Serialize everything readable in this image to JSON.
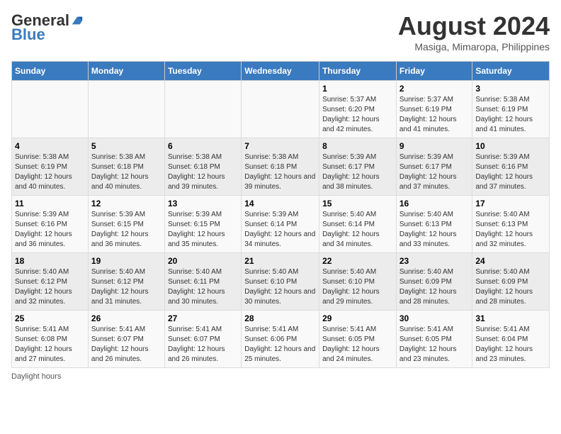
{
  "header": {
    "logo_general": "General",
    "logo_blue": "Blue",
    "month_year": "August 2024",
    "location": "Masiga, Mimaropa, Philippines"
  },
  "days_of_week": [
    "Sunday",
    "Monday",
    "Tuesday",
    "Wednesday",
    "Thursday",
    "Friday",
    "Saturday"
  ],
  "weeks": [
    [
      {
        "day": "",
        "sunrise": "",
        "sunset": "",
        "daylight": ""
      },
      {
        "day": "",
        "sunrise": "",
        "sunset": "",
        "daylight": ""
      },
      {
        "day": "",
        "sunrise": "",
        "sunset": "",
        "daylight": ""
      },
      {
        "day": "",
        "sunrise": "",
        "sunset": "",
        "daylight": ""
      },
      {
        "day": "1",
        "sunrise": "Sunrise: 5:37 AM",
        "sunset": "Sunset: 6:20 PM",
        "daylight": "Daylight: 12 hours and 42 minutes."
      },
      {
        "day": "2",
        "sunrise": "Sunrise: 5:37 AM",
        "sunset": "Sunset: 6:19 PM",
        "daylight": "Daylight: 12 hours and 41 minutes."
      },
      {
        "day": "3",
        "sunrise": "Sunrise: 5:38 AM",
        "sunset": "Sunset: 6:19 PM",
        "daylight": "Daylight: 12 hours and 41 minutes."
      }
    ],
    [
      {
        "day": "4",
        "sunrise": "Sunrise: 5:38 AM",
        "sunset": "Sunset: 6:19 PM",
        "daylight": "Daylight: 12 hours and 40 minutes."
      },
      {
        "day": "5",
        "sunrise": "Sunrise: 5:38 AM",
        "sunset": "Sunset: 6:18 PM",
        "daylight": "Daylight: 12 hours and 40 minutes."
      },
      {
        "day": "6",
        "sunrise": "Sunrise: 5:38 AM",
        "sunset": "Sunset: 6:18 PM",
        "daylight": "Daylight: 12 hours and 39 minutes."
      },
      {
        "day": "7",
        "sunrise": "Sunrise: 5:38 AM",
        "sunset": "Sunset: 6:18 PM",
        "daylight": "Daylight: 12 hours and 39 minutes."
      },
      {
        "day": "8",
        "sunrise": "Sunrise: 5:39 AM",
        "sunset": "Sunset: 6:17 PM",
        "daylight": "Daylight: 12 hours and 38 minutes."
      },
      {
        "day": "9",
        "sunrise": "Sunrise: 5:39 AM",
        "sunset": "Sunset: 6:17 PM",
        "daylight": "Daylight: 12 hours and 37 minutes."
      },
      {
        "day": "10",
        "sunrise": "Sunrise: 5:39 AM",
        "sunset": "Sunset: 6:16 PM",
        "daylight": "Daylight: 12 hours and 37 minutes."
      }
    ],
    [
      {
        "day": "11",
        "sunrise": "Sunrise: 5:39 AM",
        "sunset": "Sunset: 6:16 PM",
        "daylight": "Daylight: 12 hours and 36 minutes."
      },
      {
        "day": "12",
        "sunrise": "Sunrise: 5:39 AM",
        "sunset": "Sunset: 6:15 PM",
        "daylight": "Daylight: 12 hours and 36 minutes."
      },
      {
        "day": "13",
        "sunrise": "Sunrise: 5:39 AM",
        "sunset": "Sunset: 6:15 PM",
        "daylight": "Daylight: 12 hours and 35 minutes."
      },
      {
        "day": "14",
        "sunrise": "Sunrise: 5:39 AM",
        "sunset": "Sunset: 6:14 PM",
        "daylight": "Daylight: 12 hours and 34 minutes."
      },
      {
        "day": "15",
        "sunrise": "Sunrise: 5:40 AM",
        "sunset": "Sunset: 6:14 PM",
        "daylight": "Daylight: 12 hours and 34 minutes."
      },
      {
        "day": "16",
        "sunrise": "Sunrise: 5:40 AM",
        "sunset": "Sunset: 6:13 PM",
        "daylight": "Daylight: 12 hours and 33 minutes."
      },
      {
        "day": "17",
        "sunrise": "Sunrise: 5:40 AM",
        "sunset": "Sunset: 6:13 PM",
        "daylight": "Daylight: 12 hours and 32 minutes."
      }
    ],
    [
      {
        "day": "18",
        "sunrise": "Sunrise: 5:40 AM",
        "sunset": "Sunset: 6:12 PM",
        "daylight": "Daylight: 12 hours and 32 minutes."
      },
      {
        "day": "19",
        "sunrise": "Sunrise: 5:40 AM",
        "sunset": "Sunset: 6:12 PM",
        "daylight": "Daylight: 12 hours and 31 minutes."
      },
      {
        "day": "20",
        "sunrise": "Sunrise: 5:40 AM",
        "sunset": "Sunset: 6:11 PM",
        "daylight": "Daylight: 12 hours and 30 minutes."
      },
      {
        "day": "21",
        "sunrise": "Sunrise: 5:40 AM",
        "sunset": "Sunset: 6:10 PM",
        "daylight": "Daylight: 12 hours and 30 minutes."
      },
      {
        "day": "22",
        "sunrise": "Sunrise: 5:40 AM",
        "sunset": "Sunset: 6:10 PM",
        "daylight": "Daylight: 12 hours and 29 minutes."
      },
      {
        "day": "23",
        "sunrise": "Sunrise: 5:40 AM",
        "sunset": "Sunset: 6:09 PM",
        "daylight": "Daylight: 12 hours and 28 minutes."
      },
      {
        "day": "24",
        "sunrise": "Sunrise: 5:40 AM",
        "sunset": "Sunset: 6:09 PM",
        "daylight": "Daylight: 12 hours and 28 minutes."
      }
    ],
    [
      {
        "day": "25",
        "sunrise": "Sunrise: 5:41 AM",
        "sunset": "Sunset: 6:08 PM",
        "daylight": "Daylight: 12 hours and 27 minutes."
      },
      {
        "day": "26",
        "sunrise": "Sunrise: 5:41 AM",
        "sunset": "Sunset: 6:07 PM",
        "daylight": "Daylight: 12 hours and 26 minutes."
      },
      {
        "day": "27",
        "sunrise": "Sunrise: 5:41 AM",
        "sunset": "Sunset: 6:07 PM",
        "daylight": "Daylight: 12 hours and 26 minutes."
      },
      {
        "day": "28",
        "sunrise": "Sunrise: 5:41 AM",
        "sunset": "Sunset: 6:06 PM",
        "daylight": "Daylight: 12 hours and 25 minutes."
      },
      {
        "day": "29",
        "sunrise": "Sunrise: 5:41 AM",
        "sunset": "Sunset: 6:05 PM",
        "daylight": "Daylight: 12 hours and 24 minutes."
      },
      {
        "day": "30",
        "sunrise": "Sunrise: 5:41 AM",
        "sunset": "Sunset: 6:05 PM",
        "daylight": "Daylight: 12 hours and 23 minutes."
      },
      {
        "day": "31",
        "sunrise": "Sunrise: 5:41 AM",
        "sunset": "Sunset: 6:04 PM",
        "daylight": "Daylight: 12 hours and 23 minutes."
      }
    ]
  ],
  "footer": {
    "daylight_label": "Daylight hours"
  }
}
